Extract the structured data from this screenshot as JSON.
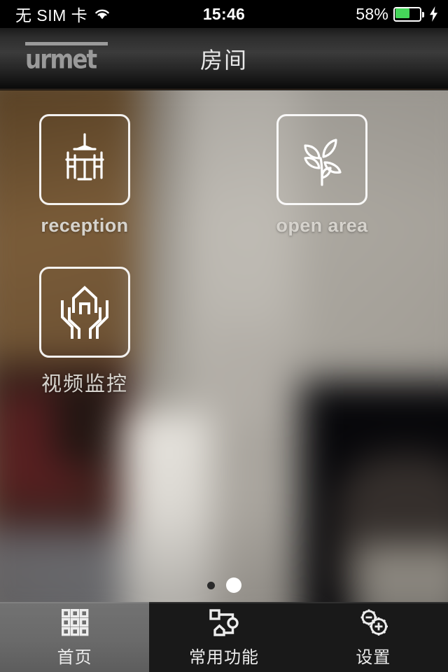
{
  "status_bar": {
    "carrier": "无 SIM 卡",
    "wifi_icon": "wifi-icon",
    "time": "15:46",
    "battery_percent_label": "58%",
    "battery_level": 58,
    "battery_color": "#45d65a",
    "charging_icon": "lightning-bolt-icon"
  },
  "header": {
    "logo_text": "urmet",
    "title": "房间"
  },
  "main": {
    "tiles": [
      {
        "label": "reception",
        "icon": "dining-table-icon",
        "lang": "en"
      },
      {
        "label": "open area",
        "icon": "plant-sprout-icon",
        "lang": "en"
      },
      {
        "label": "视频监控",
        "icon": "house-in-hands-icon",
        "lang": "cjk"
      }
    ],
    "pagination": {
      "total": 2,
      "active_index": 1
    }
  },
  "tabbar": {
    "tabs": [
      {
        "label": "首页",
        "icon": "grid-3x3-icon",
        "active": true
      },
      {
        "label": "常用功能",
        "icon": "flow-nodes-icon",
        "active": false
      },
      {
        "label": "设置",
        "icon": "gears-plus-minus-icon",
        "active": false
      }
    ]
  },
  "colors": {
    "accent_brown": "#7b6248",
    "background_gray": "#9a968f",
    "tab_active": "#6a6a6a",
    "tab_inactive": "#191919"
  }
}
